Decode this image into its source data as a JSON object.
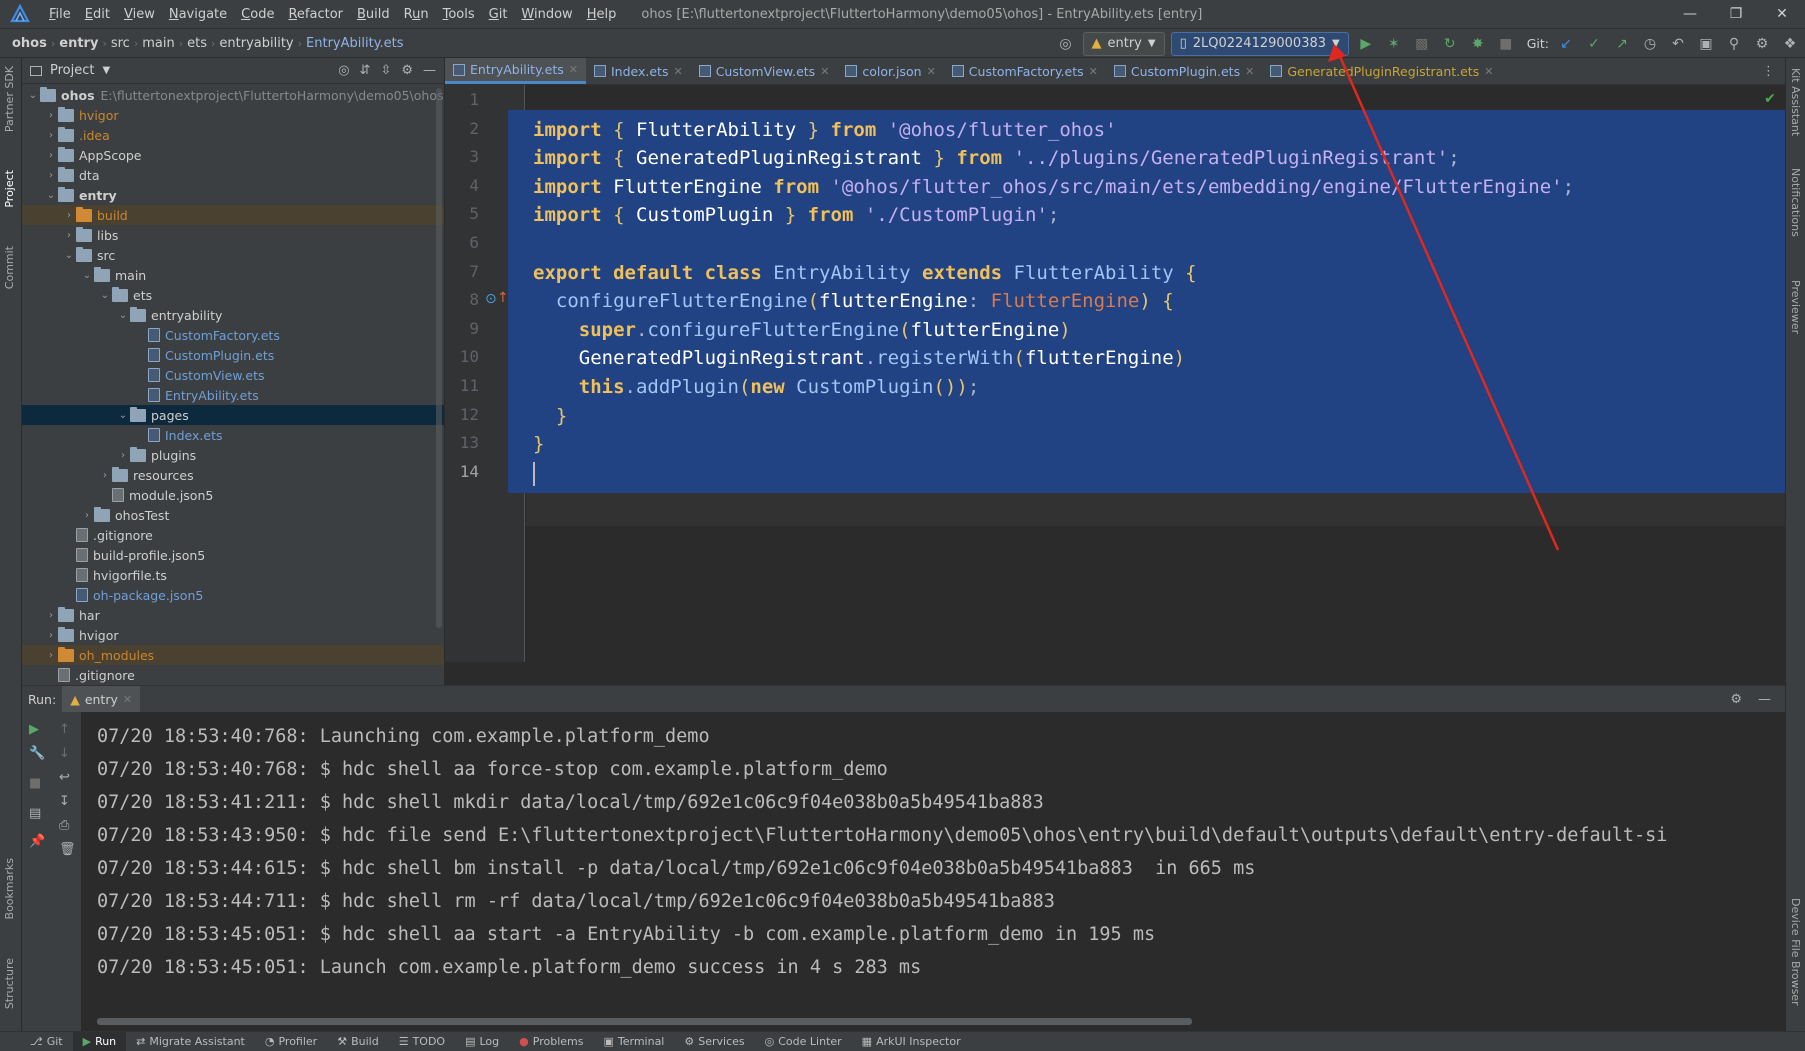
{
  "menubar": {
    "items": [
      {
        "label": "File",
        "u": "F"
      },
      {
        "label": "Edit",
        "u": "E"
      },
      {
        "label": "View",
        "u": "V"
      },
      {
        "label": "Navigate",
        "u": "N"
      },
      {
        "label": "Code",
        "u": "C"
      },
      {
        "label": "Refactor",
        "u": "R"
      },
      {
        "label": "Build",
        "u": "B"
      },
      {
        "label": "Run",
        "u": "u"
      },
      {
        "label": "Tools",
        "u": "T"
      },
      {
        "label": "Git",
        "u": "G"
      },
      {
        "label": "Window",
        "u": "W"
      },
      {
        "label": "Help",
        "u": "H"
      }
    ],
    "window_title": "ohos [E:\\fluttertonextproject\\FluttertoHarmony\\demo05\\ohos] - EntryAbility.ets [entry]"
  },
  "navbar": {
    "crumbs": [
      "ohos",
      "entry",
      "src",
      "main",
      "ets",
      "entryability",
      "EntryAbility.ets"
    ],
    "module_combo": "entry",
    "device_combo": "2LQ0224129000383",
    "git_label": "Git:"
  },
  "project": {
    "header": "Project",
    "root_name": "ohos",
    "root_path": "E:\\fluttertonextproject\\FluttertoHarmony\\demo05\\ohos",
    "items": [
      {
        "label": "hvigor",
        "depth": 1,
        "arrow": "›",
        "icon": "folder",
        "style": "orange"
      },
      {
        "label": ".idea",
        "depth": 1,
        "arrow": "›",
        "icon": "folder",
        "style": "orange"
      },
      {
        "label": "AppScope",
        "depth": 1,
        "arrow": "›",
        "icon": "folder",
        "style": ""
      },
      {
        "label": "dta",
        "depth": 1,
        "arrow": "›",
        "icon": "folder",
        "style": ""
      },
      {
        "label": "entry",
        "depth": 1,
        "arrow": "⌄",
        "icon": "folder",
        "style": "bold"
      },
      {
        "label": "build",
        "depth": 2,
        "arrow": "›",
        "icon": "folder-orange",
        "style": "orange",
        "row": "excluded"
      },
      {
        "label": "libs",
        "depth": 2,
        "arrow": "›",
        "icon": "folder",
        "style": ""
      },
      {
        "label": "src",
        "depth": 2,
        "arrow": "⌄",
        "icon": "folder",
        "style": ""
      },
      {
        "label": "main",
        "depth": 3,
        "arrow": "⌄",
        "icon": "folder",
        "style": ""
      },
      {
        "label": "ets",
        "depth": 4,
        "arrow": "⌄",
        "icon": "folder",
        "style": ""
      },
      {
        "label": "entryability",
        "depth": 5,
        "arrow": "⌄",
        "icon": "folder",
        "style": ""
      },
      {
        "label": "CustomFactory.ets",
        "depth": 6,
        "arrow": "",
        "icon": "file",
        "style": "blue"
      },
      {
        "label": "CustomPlugin.ets",
        "depth": 6,
        "arrow": "",
        "icon": "file",
        "style": "blue"
      },
      {
        "label": "CustomView.ets",
        "depth": 6,
        "arrow": "",
        "icon": "file",
        "style": "blue"
      },
      {
        "label": "EntryAbility.ets",
        "depth": 6,
        "arrow": "",
        "icon": "file",
        "style": "blue"
      },
      {
        "label": "pages",
        "depth": 5,
        "arrow": "⌄",
        "icon": "folder",
        "style": "",
        "row": "sel"
      },
      {
        "label": "Index.ets",
        "depth": 6,
        "arrow": "",
        "icon": "file",
        "style": "blue"
      },
      {
        "label": "plugins",
        "depth": 5,
        "arrow": "›",
        "icon": "folder",
        "style": ""
      },
      {
        "label": "resources",
        "depth": 4,
        "arrow": "›",
        "icon": "folder",
        "style": ""
      },
      {
        "label": "module.json5",
        "depth": 4,
        "arrow": "",
        "icon": "file-plain",
        "style": ""
      },
      {
        "label": "ohosTest",
        "depth": 3,
        "arrow": "›",
        "icon": "folder",
        "style": ""
      },
      {
        "label": ".gitignore",
        "depth": 2,
        "arrow": "",
        "icon": "file-plain",
        "style": ""
      },
      {
        "label": "build-profile.json5",
        "depth": 2,
        "arrow": "",
        "icon": "file-plain",
        "style": ""
      },
      {
        "label": "hvigorfile.ts",
        "depth": 2,
        "arrow": "",
        "icon": "file-plain",
        "style": ""
      },
      {
        "label": "oh-package.json5",
        "depth": 2,
        "arrow": "",
        "icon": "file",
        "style": "blue"
      },
      {
        "label": "har",
        "depth": 1,
        "arrow": "›",
        "icon": "folder",
        "style": ""
      },
      {
        "label": "hvigor",
        "depth": 1,
        "arrow": "›",
        "icon": "folder",
        "style": ""
      },
      {
        "label": "oh_modules",
        "depth": 1,
        "arrow": "›",
        "icon": "folder-orange",
        "style": "orange",
        "row": "excluded"
      },
      {
        "label": ".gitignore",
        "depth": 1,
        "arrow": "",
        "icon": "file-plain",
        "style": ""
      }
    ]
  },
  "editor": {
    "tabs": [
      {
        "label": "EntryAbility.ets",
        "active": true,
        "gen": false
      },
      {
        "label": "Index.ets",
        "active": false,
        "gen": false
      },
      {
        "label": "CustomView.ets",
        "active": false,
        "gen": false
      },
      {
        "label": "color.json",
        "active": false,
        "gen": false
      },
      {
        "label": "CustomFactory.ets",
        "active": false,
        "gen": false
      },
      {
        "label": "CustomPlugin.ets",
        "active": false,
        "gen": false
      },
      {
        "label": "GeneratedPluginRegistrant.ets",
        "active": false,
        "gen": true
      }
    ],
    "line_numbers": [
      "1",
      "2",
      "3",
      "4",
      "5",
      "6",
      "7",
      "8",
      "9",
      "10",
      "11",
      "12",
      "13",
      "14"
    ],
    "code_lines": [
      "",
      "import { FlutterAbility } from '@ohos/flutter_ohos'",
      "import { GeneratedPluginRegistrant } from '../plugins/GeneratedPluginRegistrant';",
      "import FlutterEngine from '@ohos/flutter_ohos/src/main/ets/embedding/engine/FlutterEngine';",
      "import { CustomPlugin } from './CustomPlugin';",
      "",
      "export default class EntryAbility extends FlutterAbility {",
      "  configureFlutterEngine(flutterEngine: FlutterEngine) {",
      "    super.configureFlutterEngine(flutterEngine)",
      "    GeneratedPluginRegistrant.registerWith(flutterEngine)",
      "    this.addPlugin(new CustomPlugin());",
      "  }",
      "}",
      ""
    ]
  },
  "run": {
    "label": "Run:",
    "tab": "entry",
    "console_lines": [
      "07/20 18:53:40:768: Launching com.example.platform_demo",
      "07/20 18:53:40:768: $ hdc shell aa force-stop com.example.platform_demo",
      "07/20 18:53:41:211: $ hdc shell mkdir data/local/tmp/692e1c06c9f04e038b0a5b49541ba883",
      "07/20 18:53:43:950: $ hdc file send E:\\fluttertonextproject\\FluttertoHarmony\\demo05\\ohos\\entry\\build\\default\\outputs\\default\\entry-default-si",
      "07/20 18:53:44:615: $ hdc shell bm install -p data/local/tmp/692e1c06c9f04e038b0a5b49541ba883  in 665 ms",
      "07/20 18:53:44:711: $ hdc shell rm -rf data/local/tmp/692e1c06c9f04e038b0a5b49541ba883",
      "07/20 18:53:45:051: $ hdc shell aa start -a EntryAbility -b com.example.platform_demo in 195 ms",
      "07/20 18:53:45:051: Launch com.example.platform_demo success in 4 s 283 ms"
    ]
  },
  "left_strip": {
    "tabs": [
      "Partner SDK",
      "Project",
      "Commit",
      "Bookmarks",
      "Structure"
    ]
  },
  "right_strip": {
    "tabs": [
      "Kit Assistant",
      "Notifications",
      "Previewer",
      "Device File Browser"
    ]
  },
  "bottombar": {
    "tabs": [
      {
        "label": "Git",
        "icon": "branch-icon"
      },
      {
        "label": "Run",
        "icon": "run-icon",
        "active": true
      },
      {
        "label": "Migrate Assistant",
        "icon": "migrate-icon"
      },
      {
        "label": "Profiler",
        "icon": "profiler-icon"
      },
      {
        "label": "Build",
        "icon": "hammer-icon"
      },
      {
        "label": "TODO",
        "icon": "list-icon"
      },
      {
        "label": "Log",
        "icon": "log-icon"
      },
      {
        "label": "Problems",
        "icon": "problems-icon"
      },
      {
        "label": "Terminal",
        "icon": "terminal-icon"
      },
      {
        "label": "Services",
        "icon": "services-icon"
      },
      {
        "label": "Code Linter",
        "icon": "linter-icon"
      },
      {
        "label": "ArkUI Inspector",
        "icon": "inspector-icon"
      }
    ]
  },
  "colors": {
    "accent": "#4a88c7",
    "selection": "#214283",
    "annotation_arrow": "#e0281f"
  }
}
